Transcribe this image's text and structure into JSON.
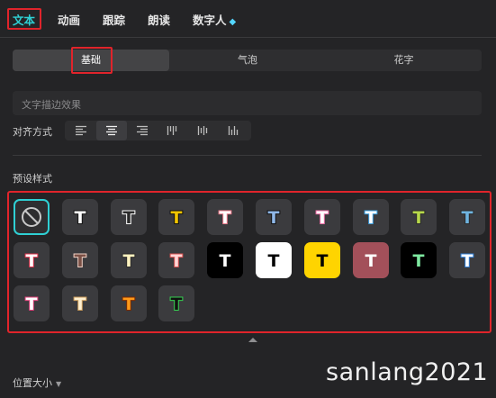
{
  "tabs": [
    {
      "label": "文本",
      "active": true
    },
    {
      "label": "动画",
      "active": false
    },
    {
      "label": "跟踪",
      "active": false
    },
    {
      "label": "朗读",
      "active": false
    },
    {
      "label": "数字人",
      "active": false,
      "badge_icon": "diamond-icon"
    }
  ],
  "segments": [
    {
      "label": "基础",
      "active": true
    },
    {
      "label": "气泡",
      "active": false
    },
    {
      "label": "花字",
      "active": false
    }
  ],
  "stroke_effect": {
    "label": "文字描边效果"
  },
  "alignment": {
    "label": "对齐方式",
    "options": [
      "align-left-icon",
      "align-center-icon",
      "align-right-icon",
      "vertical-align-top-icon",
      "vertical-align-center-icon",
      "vertical-align-bottom-icon"
    ],
    "selected_index": 1
  },
  "presets": {
    "label": "预设样式",
    "items": [
      {
        "kind": "none",
        "icon": "no-style-icon",
        "selected": true
      },
      {
        "letter": "T",
        "fill": "#ffffff",
        "stroke": "#111111",
        "bg": "#3b3b3e"
      },
      {
        "letter": "T",
        "fill": "#2b2b2b",
        "stroke": "#ffffff",
        "bg": "#3b3b3e"
      },
      {
        "letter": "T",
        "fill": "#f2c500",
        "stroke": "#111111",
        "bg": "#3b3b3e"
      },
      {
        "letter": "T",
        "fill": "#ffffff",
        "stroke": "#f07b8c",
        "bg": "#3b3b3e"
      },
      {
        "letter": "T",
        "fill": "#8fb7e8",
        "stroke": "#111111",
        "bg": "#3b3b3e"
      },
      {
        "letter": "T",
        "fill": "#ffffff",
        "stroke": "#f06fa8",
        "bg": "#3b3b3e"
      },
      {
        "letter": "T",
        "fill": "#ffffff",
        "stroke": "#3a9fe0",
        "bg": "#3b3b3e"
      },
      {
        "letter": "T",
        "fill": "#b7d84a",
        "stroke": "#2b2b2b",
        "bg": "#3b3b3e"
      },
      {
        "letter": "T",
        "fill": "#6fb4e0",
        "stroke": "#2b2b2b",
        "bg": "#3b3b3e"
      },
      {
        "letter": "T",
        "fill": "#ffffff",
        "stroke": "#e0304a",
        "bg": "#3b3b3e"
      },
      {
        "letter": "T",
        "fill": "#7a5046",
        "stroke": "#f0d0c4",
        "bg": "#3b3b3e"
      },
      {
        "letter": "T",
        "fill": "#fff3c0",
        "stroke": "#2b2b2b",
        "bg": "#3b3b3e"
      },
      {
        "letter": "T",
        "fill": "#ffd6d6",
        "stroke": "#d85050",
        "bg": "#3b3b3e"
      },
      {
        "letter": "T",
        "fill": "#ffffff",
        "stroke": "#000000",
        "bg": "#000000"
      },
      {
        "letter": "T",
        "fill": "#000000",
        "stroke": "#ffffff",
        "bg": "#ffffff"
      },
      {
        "letter": "T",
        "fill": "#000000",
        "stroke": "#ffd400",
        "bg": "#ffd400"
      },
      {
        "letter": "T",
        "fill": "#ffffff",
        "stroke": "#a3505a",
        "bg": "#a3505a"
      },
      {
        "letter": "T",
        "fill": "#7ee8a0",
        "stroke": "#000000",
        "bg": "#000000"
      },
      {
        "letter": "T",
        "fill": "#ffffff",
        "stroke": "#2f7fd8",
        "bg": "#3b3b3e"
      },
      {
        "letter": "T",
        "fill": "#ffffff",
        "stroke": "#e0407a",
        "bg": "#3b3b3e"
      },
      {
        "letter": "T",
        "fill": "#fff0d0",
        "stroke": "#c89a5a",
        "bg": "#3b3b3e"
      },
      {
        "letter": "T",
        "fill": "#ff9a1a",
        "stroke": "#7a2a00",
        "bg": "#3b3b3e"
      },
      {
        "letter": "T",
        "fill": "#111111",
        "stroke": "#35d050",
        "bg": "#3b3b3e"
      }
    ]
  },
  "position_size": {
    "label": "位置大小"
  },
  "watermark": "sanlang2021",
  "colors": {
    "accent": "#2fd0d4",
    "highlight_box": "#e0242b",
    "panel_bg": "#242426"
  }
}
